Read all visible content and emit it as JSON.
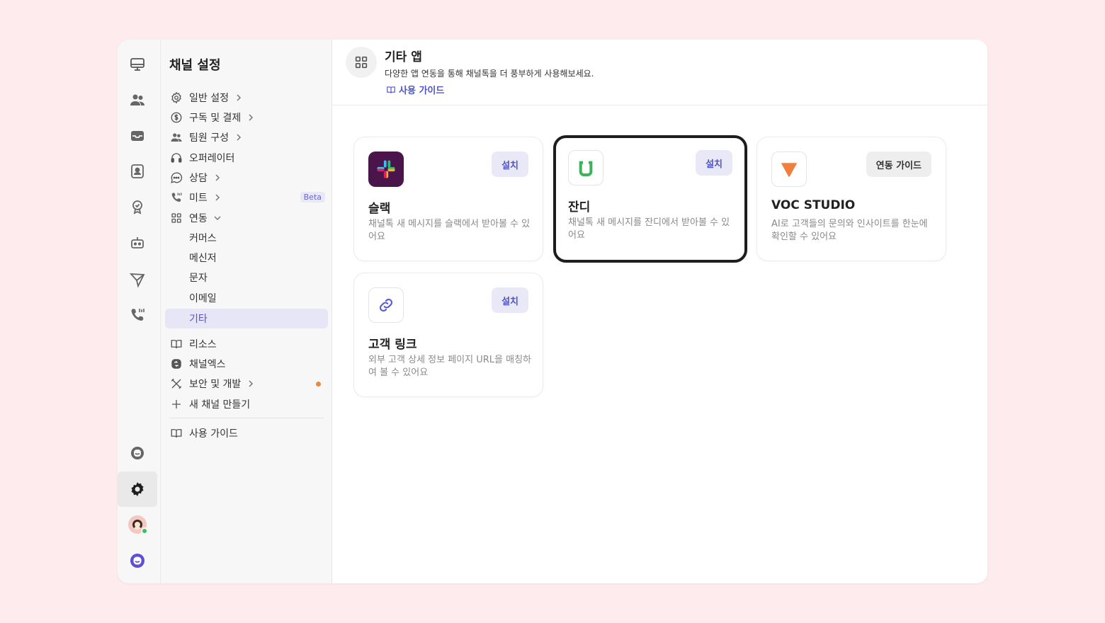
{
  "settings_panel": {
    "title": "채널 설정",
    "items": [
      {
        "label": "일반 설정",
        "icon": "gear-icon"
      },
      {
        "label": "구독 및 결제",
        "icon": "dollar-icon"
      },
      {
        "label": "팀원 구성",
        "icon": "team-icon"
      },
      {
        "label": "오퍼레이터",
        "icon": "headset-icon"
      },
      {
        "label": "상담",
        "icon": "chat-icon"
      },
      {
        "label": "미트",
        "icon": "phone-icon",
        "badge": "Beta"
      },
      {
        "label": "연동",
        "icon": "grid-icon"
      }
    ],
    "sub_items": [
      "커머스",
      "메신저",
      "문자",
      "이메일",
      "기타"
    ],
    "selected_sub": "기타",
    "bottom_items": [
      {
        "label": "리소스",
        "icon": "book-icon"
      },
      {
        "label": "채널엑스",
        "icon": "channel-x-icon"
      },
      {
        "label": "보안 및 개발",
        "icon": "tools-icon"
      },
      {
        "label": "새 채널 만들기",
        "icon": "plus-icon"
      }
    ],
    "guide_label": "사용 가이드"
  },
  "header": {
    "title": "기타 앱",
    "subtitle": "다양한 앱 연동을 통해 채널톡을 더 풍부하게 사용해보세요.",
    "guide_link": "사용 가이드"
  },
  "apps": [
    {
      "name": "슬랙",
      "description": "채널톡 새 메시지를 슬랙에서 받아볼 수 있어요",
      "button": "설치",
      "icon": "slack-logo-icon"
    },
    {
      "name": "잔디",
      "description": "채널톡 새 메시지를 잔디에서 받아볼 수 있어요",
      "button": "설치",
      "icon": "jandi-logo-icon"
    },
    {
      "name": "VOC STUDIO",
      "description": "AI로 고객들의 문의와 인사이트를 한눈에 확인할 수 있어요",
      "button": "연동 가이드",
      "icon": "voc-studio-logo-icon"
    },
    {
      "name": "고객 링크",
      "description": "외부 고객 상세 정보 페이지 URL을 매칭하여 볼 수 있어요",
      "button": "설치",
      "icon": "link-icon"
    }
  ],
  "colors": {
    "accent": "#4f55c8",
    "selected_bg": "#e7e6f7",
    "page_bg": "#fdebee",
    "status_online": "#3dbf5a",
    "notice_dot": "#f0883a"
  }
}
